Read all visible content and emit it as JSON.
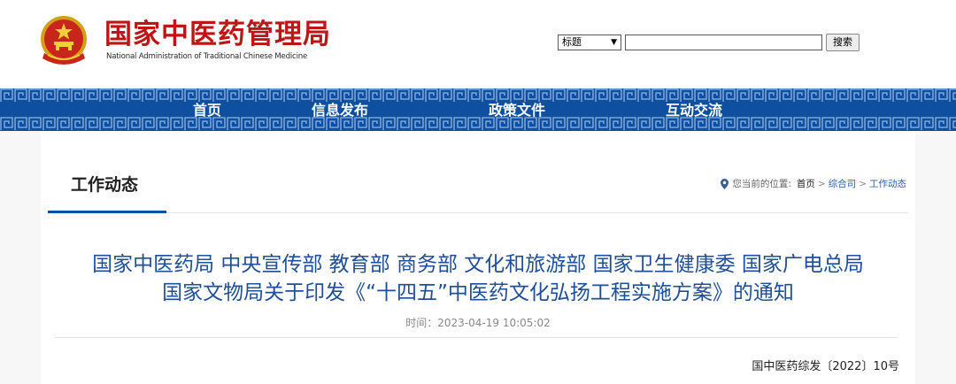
{
  "header": {
    "title": "国家中医药管理局",
    "subtitle": "National Administration of Traditional Chinese Medicine",
    "emblem_icon": "national-emblem-icon"
  },
  "search": {
    "field_selected": "标题",
    "input_value": "",
    "button_label": "搜索"
  },
  "nav": {
    "items": [
      {
        "label": "首页"
      },
      {
        "label": "信息发布"
      },
      {
        "label": "政策文件"
      },
      {
        "label": "互动交流"
      }
    ],
    "color": "#0e4fa0"
  },
  "section": {
    "title": "工作动态"
  },
  "breadcrumb": {
    "prefix": "您当前的位置:",
    "items": [
      "首页",
      "综合司",
      "工作动态"
    ],
    "separator": ">"
  },
  "article": {
    "title_line1": "国家中医药局 中央宣传部 教育部 商务部 文化和旅游部 国家卫生健康委 国家广电总局",
    "title_line2": "国家文物局关于印发《“十四五”中医药文化弘扬工程实施方案》的通知",
    "time_label": "时间：",
    "time_value": "2023-04-19 10:05:02",
    "doc_number": "国中医药综发〔2022〕10号"
  },
  "colors": {
    "brand_red": "#bf1515",
    "brand_blue": "#0e4fa0",
    "title_blue": "#1f4f99"
  }
}
